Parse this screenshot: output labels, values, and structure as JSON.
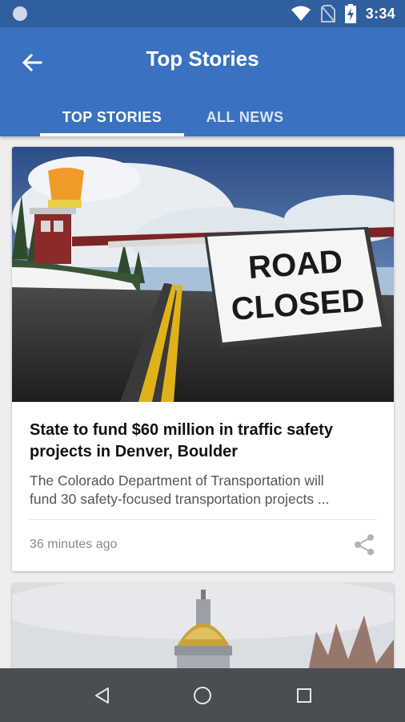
{
  "status_bar": {
    "time": "3:34"
  },
  "app_bar": {
    "title": "Top Stories"
  },
  "tabs": [
    {
      "label": "TOP STORIES",
      "selected": true
    },
    {
      "label": "ALL NEWS",
      "selected": false
    }
  ],
  "stories": [
    {
      "image_text": [
        "ROAD",
        "CLOSED"
      ],
      "headline": "State to fund $60 million in traffic safety projects in Denver, Boulder",
      "summary_lines": [
        "The Colorado Department of Transportation will",
        "fund 30 safety-focused transportation projects ..."
      ],
      "time_ago": "36 minutes ago"
    }
  ],
  "colors": {
    "status_bar": "#2f5f9f",
    "app_bar": "#3a71c0",
    "nav_bar": "#4a4e52"
  },
  "icons": {
    "back": "arrow-left-icon",
    "share": "share-icon",
    "nav_back": "triangle-back-icon",
    "nav_home": "circle-home-icon",
    "nav_recents": "square-recents-icon"
  }
}
